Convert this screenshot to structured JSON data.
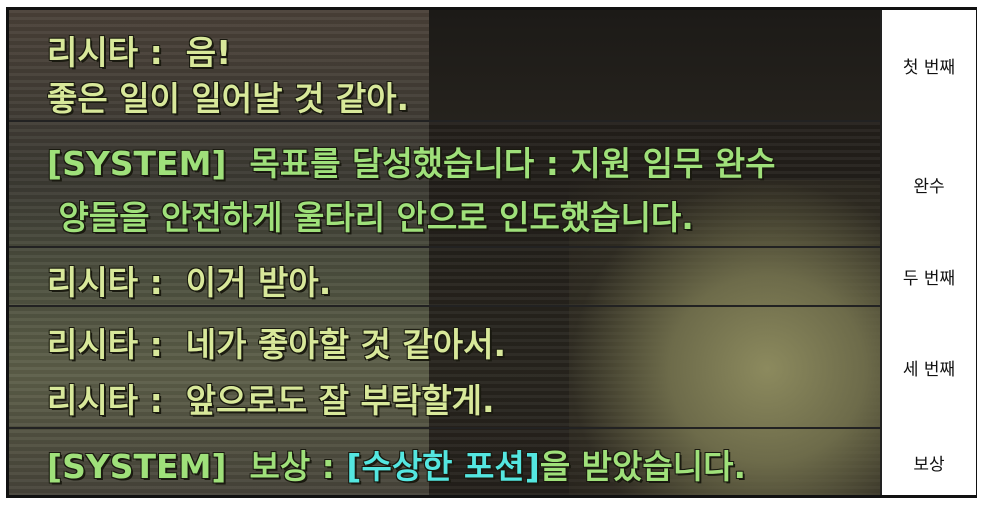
{
  "rows": [
    {
      "label": "첫 번째",
      "lines": [
        {
          "speaker": "리시타",
          "sep": " :  ",
          "text": "음!"
        },
        {
          "text": "좋은 일이 일어날 것 같아."
        }
      ]
    },
    {
      "label": "완수",
      "lines": [
        {
          "speaker": "[SYSTEM]",
          "text": "  목표를 달성했습니다 : 지원 임무 완수"
        },
        {
          "text": " 양들을 안전하게 울타리 안으로 인도했습니다."
        }
      ]
    },
    {
      "label": "두 번째",
      "lines": [
        {
          "speaker": "리시타",
          "sep": " :  ",
          "text": "이거 받아."
        }
      ]
    },
    {
      "label": "세 번째",
      "lines": [
        {
          "speaker": "리시타",
          "sep": " :  ",
          "text": "네가 좋아할 것 같아서."
        },
        {
          "speaker": "리시타",
          "sep": " :  ",
          "text": "앞으로도 잘 부탁할게."
        }
      ]
    },
    {
      "label": "보상",
      "lines": [
        {
          "speaker": "[SYSTEM]",
          "text_before": "  보상 : ",
          "item": "[수상한 포션]",
          "text_after": "을 받았습니다."
        }
      ]
    }
  ],
  "colors": {
    "speaker": "#d8e89a",
    "system": "#9fe07a",
    "item": "#54e6e0"
  }
}
